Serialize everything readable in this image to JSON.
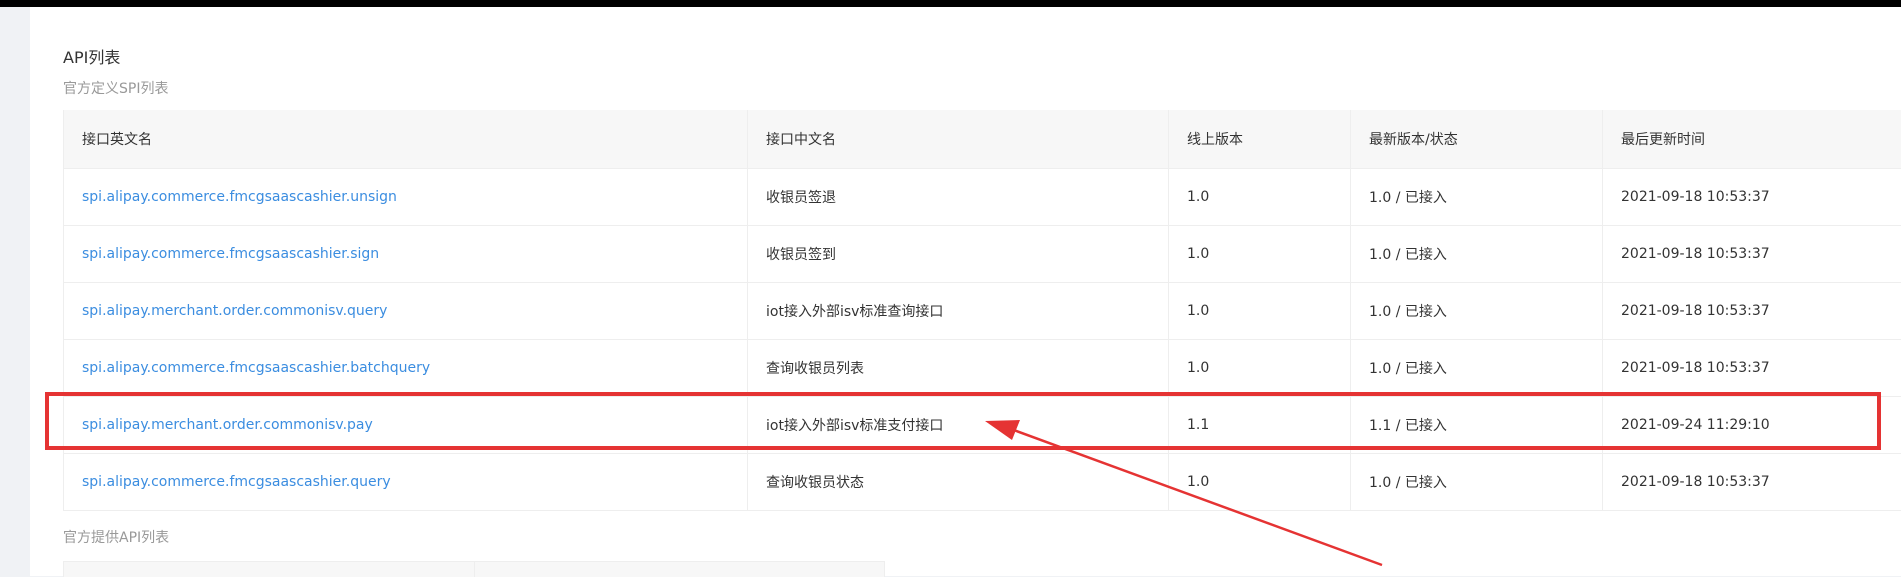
{
  "page": {
    "title": "API列表",
    "spi_section_label": "官方定义SPI列表",
    "api_section_label": "官方提供API列表"
  },
  "table": {
    "headers": [
      "接口英文名",
      "接口中文名",
      "线上版本",
      "最新版本/状态",
      "最后更新时间"
    ],
    "rows": [
      [
        "spi.alipay.commerce.fmcgsaascashier.unsign",
        "收银员签退",
        "1.0",
        "1.0 / 已接入",
        "2021-09-18 10:53:37"
      ],
      [
        "spi.alipay.commerce.fmcgsaascashier.sign",
        "收银员签到",
        "1.0",
        "1.0 / 已接入",
        "2021-09-18 10:53:37"
      ],
      [
        "spi.alipay.merchant.order.commonisv.query",
        "iot接入外部isv标准查询接口",
        "1.0",
        "1.0 / 已接入",
        "2021-09-18 10:53:37"
      ],
      [
        "spi.alipay.commerce.fmcgsaascashier.batchquery",
        "查询收银员列表",
        "1.0",
        "1.0 / 已接入",
        "2021-09-18 10:53:37"
      ],
      [
        "spi.alipay.merchant.order.commonisv.pay",
        "iot接入外部isv标准支付接口",
        "1.1",
        "1.1 / 已接入",
        "2021-09-24 11:29:10"
      ],
      [
        "spi.alipay.commerce.fmcgsaascashier.query",
        "查询收银员状态",
        "1.0",
        "1.0 / 已接入",
        "2021-09-18 10:53:37"
      ]
    ]
  },
  "annotation": {
    "highlighted_row": 4,
    "color": "#e53333"
  },
  "colors": {
    "link": "#3b8de0",
    "header_bg": "#f7f7f7",
    "muted_text": "#999999"
  }
}
